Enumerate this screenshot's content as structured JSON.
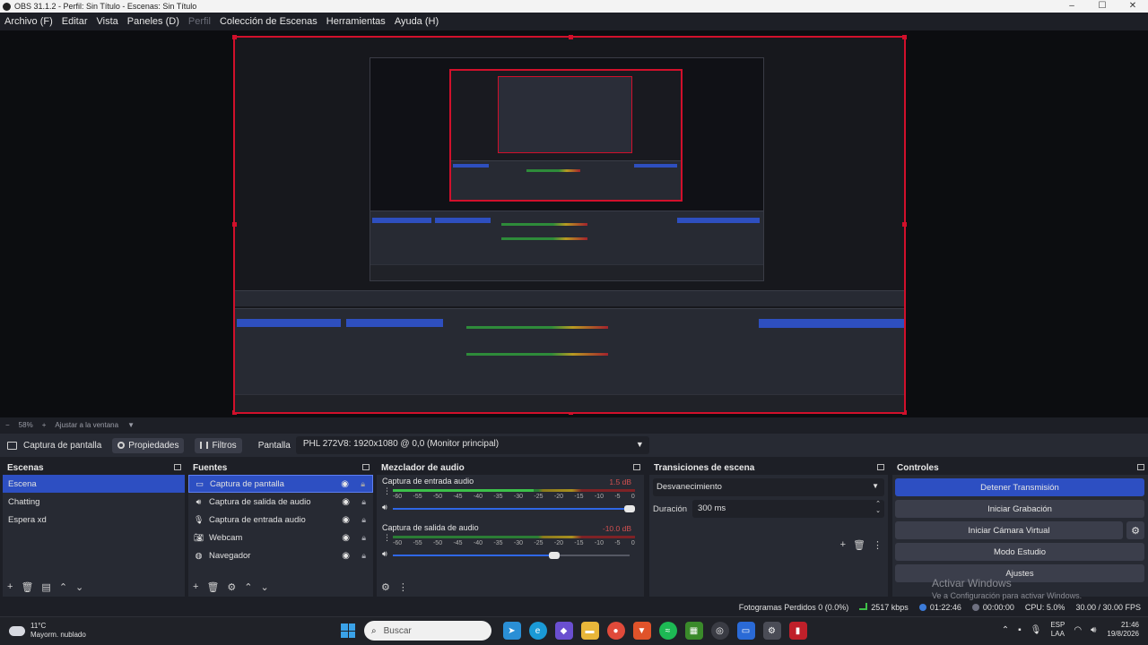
{
  "window": {
    "title": "OBS 31.1.2 - Perfil: Sin Título - Escenas: Sin Título",
    "controls": [
      "–",
      "☐",
      "✕"
    ]
  },
  "menu": [
    {
      "label": "Archivo (F)",
      "disabled": false
    },
    {
      "label": "Editar",
      "disabled": false
    },
    {
      "label": "Vista",
      "disabled": false
    },
    {
      "label": "Paneles (D)",
      "disabled": false
    },
    {
      "label": "Perfil",
      "disabled": true
    },
    {
      "label": "Colección de Escenas",
      "disabled": false
    },
    {
      "label": "Herramientas",
      "disabled": false
    },
    {
      "label": "Ayuda (H)",
      "disabled": false
    }
  ],
  "zoom": {
    "minus": "−",
    "value": "58%",
    "plus": "+",
    "fit_label": "Ajustar a la ventana",
    "caret": "▼"
  },
  "source_toolbar": {
    "source_name": "Captura de pantalla",
    "properties_label": "Propiedades",
    "filters_label": "Filtros",
    "display_label": "Pantalla",
    "display_value": "PHL 272V8: 1920x1080 @ 0,0 (Monitor principal)"
  },
  "scenes": {
    "title": "Escenas",
    "items": [
      {
        "label": "Escena",
        "selected": true
      },
      {
        "label": "Chatting",
        "selected": false
      },
      {
        "label": "Espera xd",
        "selected": false
      }
    ]
  },
  "sources": {
    "title": "Fuentes",
    "items": [
      {
        "label": "Captura de pantalla",
        "icon": "monitor-icon",
        "selected": true
      },
      {
        "label": "Captura de salida de audio",
        "icon": "speaker-icon",
        "selected": false
      },
      {
        "label": "Captura de entrada audio",
        "icon": "microphone-icon",
        "selected": false
      },
      {
        "label": "Webcam",
        "icon": "camera-icon",
        "selected": false
      },
      {
        "label": "Navegador",
        "icon": "globe-icon",
        "selected": false
      }
    ]
  },
  "mixer": {
    "title": "Mezclador de audio",
    "ticks": [
      "-60",
      "-55",
      "-50",
      "-45",
      "-40",
      "-35",
      "-30",
      "-25",
      "-20",
      "-15",
      "-10",
      "-5",
      "0"
    ],
    "tracks": [
      {
        "name": "Captura de entrada audio",
        "db": "1.5 dB",
        "db_color": "#d05050",
        "level": 0.58,
        "volume": 1.0
      },
      {
        "name": "Captura de salida de audio",
        "db": "-10.0 dB",
        "db_color": "#d05050",
        "level": 0.0,
        "volume": 0.68
      }
    ]
  },
  "transitions": {
    "title": "Transiciones de escena",
    "selected": "Desvanecimiento",
    "duration_label": "Duración",
    "duration_value": "300 ms"
  },
  "controls": {
    "title": "Controles",
    "stop_stream": "Detener Transmisión",
    "start_record": "Iniciar Grabación",
    "virtual_cam": "Iniciar Cámara Virtual",
    "studio_mode": "Modo Estudio",
    "settings": "Ajustes",
    "watermark_title": "Activar Windows",
    "watermark_sub": "Ve a Configuración para activar Windows."
  },
  "status": {
    "dropped_frames": "Fotogramas Perdidos 0 (0.0%)",
    "bitrate": "2517 kbps",
    "stream_time": "01:22:46",
    "record_time": "00:00:00",
    "cpu": "CPU: 5.0%",
    "fps": "30.00 / 30.00 FPS"
  },
  "taskbar": {
    "temp": "11°C",
    "weather": "Mayorm. nublado",
    "search_placeholder": "Buscar",
    "lang_top": "ESP",
    "lang_bottom": "LAA",
    "time": "21:46",
    "date": "19/8/2026"
  },
  "colors": {
    "accent_blue": "#2d4fc2",
    "preview_border": "#d1102b",
    "panel_bg": "#272a33",
    "window_bg": "#1d1f26"
  }
}
